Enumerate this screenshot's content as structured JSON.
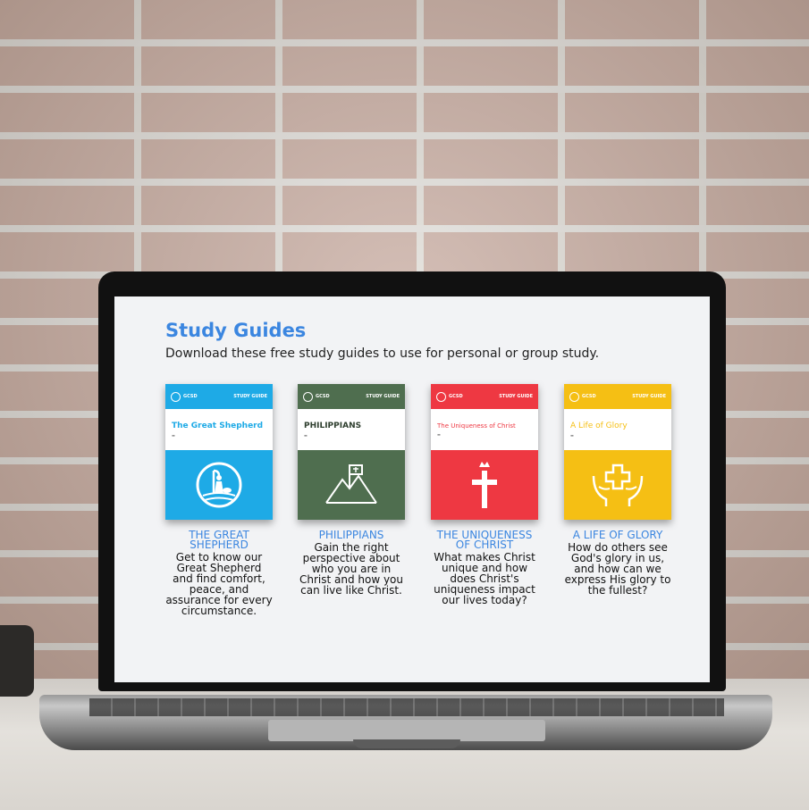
{
  "page": {
    "title": "Study Guides",
    "subtitle": "Download these free study guides to use for personal or group study."
  },
  "guides": [
    {
      "cover_title": "The Great Shepherd",
      "heading": "THE GREAT SHEPHERD",
      "description": "Get to know our Great Shepherd and find comfort, peace, and assurance for every circumstance.",
      "color": "#1eaae6",
      "title_color": "#1eaae6",
      "icon": "shepherd-icon"
    },
    {
      "cover_title": "PHILIPPIANS",
      "heading": "PHILIPPIANS",
      "description": "Gain the right perspective about who you are in Christ and how you can live like Christ.",
      "color": "#4f6e4f",
      "title_color": "#2e3e2e",
      "icon": "mountain-flag-icon"
    },
    {
      "cover_title": "The Uniqueness of Christ",
      "heading": "THE UNIQUENESS OF CHRIST",
      "description": "What makes Christ unique and how does Christ's uniqueness impact our lives today?",
      "color": "#ee3842",
      "title_color": "#ee3842",
      "icon": "cross-crown-icon"
    },
    {
      "cover_title": "A Life of Glory",
      "heading": "A LIFE OF GLORY",
      "description": "How do others see God's glory in us, and how can we express His glory to the fullest?",
      "color": "#f5bf14",
      "title_color": "#f5bf14",
      "icon": "hands-cross-icon"
    }
  ],
  "second_row_colors": [
    "#e2b60e",
    "#6a2c90",
    "#1aa38f",
    "#3f5da8"
  ]
}
